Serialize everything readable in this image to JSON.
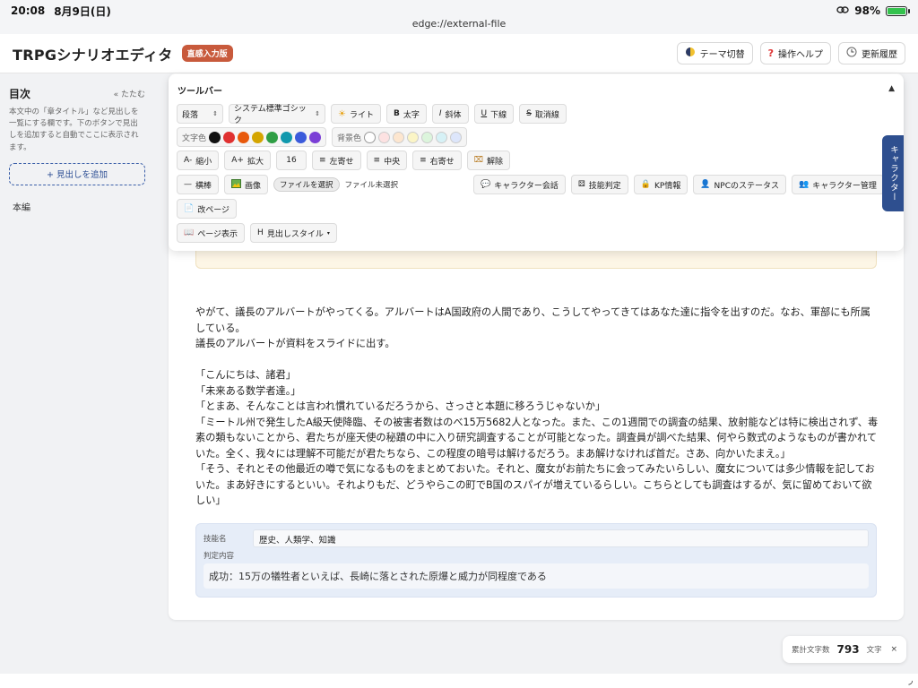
{
  "status": {
    "time": "20:08",
    "date": "8月9日(日)",
    "battery": "98%",
    "battery_level": 0.98
  },
  "url": "edge://external-file",
  "header": {
    "title": "TRPGシナリオエディタ",
    "badge": "直感入力版",
    "buttons": {
      "theme": "テーマ切替",
      "help": "操作ヘルプ",
      "history": "更新履歴"
    }
  },
  "sidebar": {
    "title": "目次",
    "collapse": "« たたむ",
    "description": "本文中の「章タイトル」など見出しを一覧にする欄です。下のボタンで見出しを追加すると自動でここに表示されます。",
    "add_button": "+ 見出しを追加",
    "items": [
      "本編"
    ]
  },
  "toolbar": {
    "title": "ツールバー",
    "toggle": "▲",
    "paragraph": "段落",
    "font": "システム標準ゴシック",
    "light": "ライト",
    "bold": "太字",
    "italic": "斜体",
    "underline": "下線",
    "strike": "取消線",
    "text_color_label": "文字色",
    "bg_color_label": "背景色",
    "text_colors": [
      "#111111",
      "#e03131",
      "#e8590c",
      "#d4a500",
      "#2f9e44",
      "#1098ad",
      "#3b5bdb",
      "#7b3fd6"
    ],
    "bg_colors": [
      "#ffffff",
      "#fde2e2",
      "#fde6cf",
      "#fbf5c6",
      "#dcf5dc",
      "#d6f1f6",
      "#dde6fb"
    ],
    "shrink": "縮小",
    "enlarge": "拡大",
    "size": "16",
    "align_left": "左寄せ",
    "align_center": "中央",
    "align_right": "右寄せ",
    "clear": "解除",
    "hr": "横棒",
    "image": "画像",
    "file_select": "ファイルを選択",
    "file_none": "ファイル未選択",
    "char_talk": "キャラクター会話",
    "skill_check": "技能判定",
    "kp_info": "KP情報",
    "npc_status": "NPCのステータス",
    "char_manage": "キャラクター管理",
    "page_break": "改ページ",
    "page_view": "ページ表示",
    "heading_style": "見出しスタイル",
    "btn_prefix": {
      "shrink": "A-",
      "enlarge": "A+",
      "bold": "B",
      "italic": "I",
      "underline": "U",
      "strike": "S",
      "heading": "H"
    }
  },
  "side_tab": "キャラクター",
  "body": {
    "paragraphs": [
      "やがて、議長のアルバートがやってくる。アルバートはA国政府の人間であり、こうしてやってきてはあなた達に指令を出すのだ。なお、軍部にも所属している。",
      "議長のアルバートが資料をスライドに出す。",
      "",
      "「こんにちは、諸君」",
      "「未来ある数学者達。」",
      "「とまあ、そんなことは言われ慣れているだろうから、さっさと本題に移ろうじゃないか」",
      "「ミートル州で発生したA級天使降臨、その被害者数はのべ15万5682人となった。また、この1週間での調査の結果、放射能などは特に検出されず、毒素の類もないことから、君たちが座天使の秘蹟の中に入り研究調査することが可能となった。調査員が調べた結果、何やら数式のようなものが書かれていた。全く、我々には理解不可能だが君たちなら、この程度の暗号は解けるだろう。まあ解けなければ首だ。さあ、向かいたまえ。」",
      "「そう、それとその他最近の噂で気になるものをまとめておいた。それと、魔女がお前たちに会ってみたいらしい、魔女については多少情報を記しておいた。まあ好きにするといい。それよりもだ、どうやらこの町でB国のスパイが増えているらしい。こちらとしても調査はするが、気に留めておいて欲しい」"
    ]
  },
  "skill_block": {
    "name_label": "技能名",
    "name_value": "歴史、人類学、知識",
    "judge_label": "判定内容",
    "judge_value": "成功：15万の犠牲者といえば、長崎に落とされた原爆と威力が同程度である"
  },
  "wordcount": {
    "label": "累計文字数",
    "count": "793",
    "unit": "文字",
    "close": "×"
  }
}
